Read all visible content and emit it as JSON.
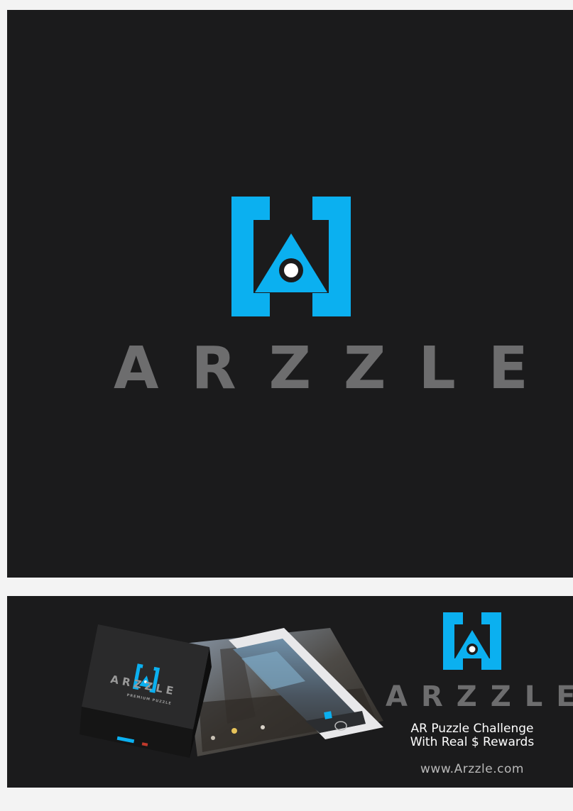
{
  "brand": {
    "name": "ARZZLE",
    "accent_color": "#0bb0f0",
    "wordmark_color": "#6d6d6e",
    "background_color": "#1b1b1c"
  },
  "logo": {
    "icon": "arzzle-bracket-a-icon"
  },
  "banner": {
    "tagline_line1": "AR Puzzle Challenge",
    "tagline_line2": "With Real $ Rewards",
    "website": "www.Arzzle.com",
    "box_label": "ARZZLE",
    "box_sublabel": "PREMIUM PUZZLE"
  }
}
